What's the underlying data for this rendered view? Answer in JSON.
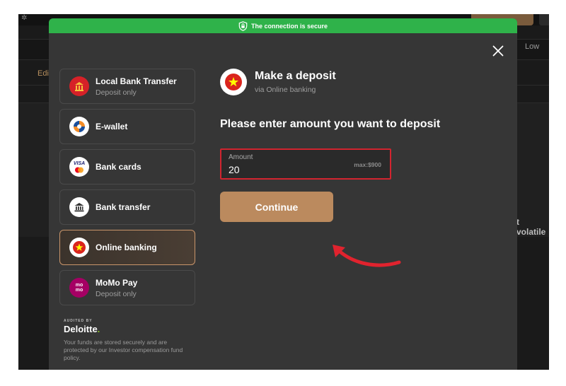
{
  "background": {
    "edit_label": "Edi",
    "low_label": "Low",
    "volatile_label": "t volatile"
  },
  "secure_bar": {
    "text": "The connection is secure"
  },
  "methods": [
    {
      "title": "Local Bank Transfer",
      "subtitle": "Deposit only",
      "icon": "bank-building-icon"
    },
    {
      "title": "E-wallet",
      "subtitle": "",
      "icon": "ewallet-icon"
    },
    {
      "title": "Bank cards",
      "subtitle": "",
      "icon": "visa-mastercard-icon"
    },
    {
      "title": "Bank transfer",
      "subtitle": "",
      "icon": "bank-icon"
    },
    {
      "title": "Online banking",
      "subtitle": "",
      "icon": "vietnam-flag-icon",
      "active": true
    },
    {
      "title": "MoMo Pay",
      "subtitle": "Deposit only",
      "icon": "momo-icon"
    }
  ],
  "audit": {
    "label": "AUDITED BY",
    "brand": "Deloitte",
    "brand_dot": ".",
    "text": "Your funds are stored securely and are protected by our Investor compensation fund policy."
  },
  "deposit": {
    "title": "Make a deposit",
    "subtitle": "via Online banking",
    "prompt": "Please enter amount you want to deposit",
    "amount_label": "Amount",
    "amount_value": "20",
    "amount_max": "max:$900",
    "continue_label": "Continue"
  },
  "colors": {
    "secure_green": "#2fb24a",
    "accent": "#bb8a5e",
    "highlight_red": "#d2242f",
    "modal_bg": "#363636"
  }
}
